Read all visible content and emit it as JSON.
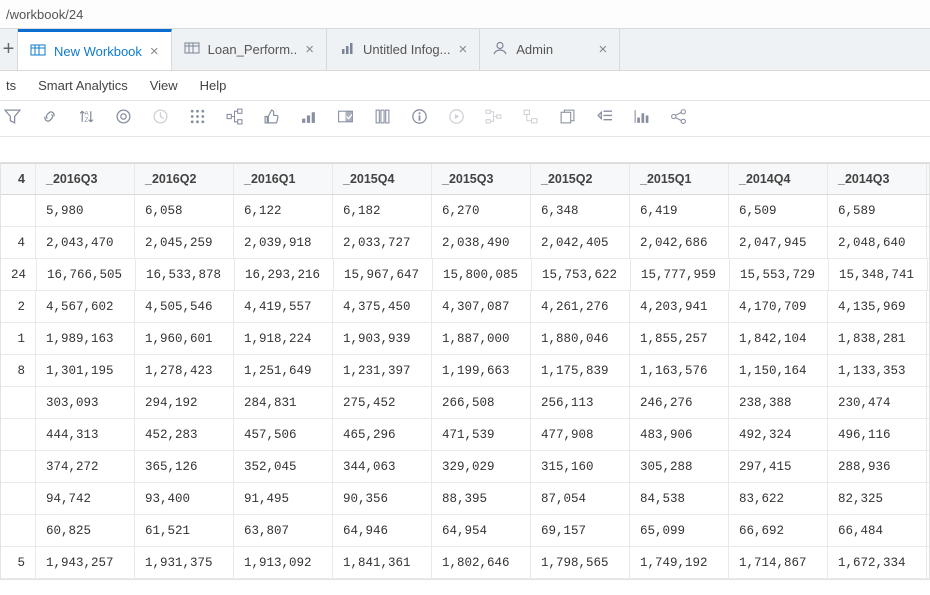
{
  "url": "/workbook/24",
  "tabs": [
    {
      "label": "New Workbook",
      "kind": "workbook",
      "active": true
    },
    {
      "label": "Loan_Perform..",
      "kind": "workbook",
      "active": false
    },
    {
      "label": "Untitled Infog...",
      "kind": "infographic",
      "active": false
    },
    {
      "label": "Admin",
      "kind": "admin",
      "active": false
    }
  ],
  "menu": {
    "m0": "ts",
    "m1": "Smart Analytics",
    "m2": "View",
    "m3": "Help"
  },
  "toolbar_icons": [
    "funnel-icon",
    "link-icon",
    "sort-icon",
    "ring-icon",
    "clock-icon",
    "grid-dots-icon",
    "tree-icon",
    "thumbs-up-icon",
    "bars-step-icon",
    "kpi-card-icon",
    "columns-icon",
    "info-icon",
    "play-icon",
    "flow1-icon",
    "flow2-icon",
    "copy-out-icon",
    "outdent-icon",
    "bar-chart-icon",
    "share-nodes-icon"
  ],
  "chart_data": {
    "type": "table",
    "title": "",
    "columns": [
      "_2016Q3",
      "_2016Q2",
      "_2016Q1",
      "_2015Q4",
      "_2015Q3",
      "_2015Q2",
      "_2015Q1",
      "_2014Q4",
      "_2014Q3"
    ],
    "row_leads": [
      "",
      "4",
      "24",
      "2",
      "1",
      "8",
      "",
      "",
      "",
      "",
      "",
      "5"
    ],
    "rows": [
      [
        "5,980",
        "6,058",
        "6,122",
        "6,182",
        "6,270",
        "6,348",
        "6,419",
        "6,509",
        "6,589"
      ],
      [
        "2,043,470",
        "2,045,259",
        "2,039,918",
        "2,033,727",
        "2,038,490",
        "2,042,405",
        "2,042,686",
        "2,047,945",
        "2,048,640"
      ],
      [
        "16,766,505",
        "16,533,878",
        "16,293,216",
        "15,967,647",
        "15,800,085",
        "15,753,622",
        "15,777,959",
        "15,553,729",
        "15,348,741"
      ],
      [
        "4,567,602",
        "4,505,546",
        "4,419,557",
        "4,375,450",
        "4,307,087",
        "4,261,276",
        "4,203,941",
        "4,170,709",
        "4,135,969"
      ],
      [
        "1,989,163",
        "1,960,601",
        "1,918,224",
        "1,903,939",
        "1,887,000",
        "1,880,046",
        "1,855,257",
        "1,842,104",
        "1,838,281"
      ],
      [
        "1,301,195",
        "1,278,423",
        "1,251,649",
        "1,231,397",
        "1,199,663",
        "1,175,839",
        "1,163,576",
        "1,150,164",
        "1,133,353"
      ],
      [
        "303,093",
        "294,192",
        "284,831",
        "275,452",
        "266,508",
        "256,113",
        "246,276",
        "238,388",
        "230,474"
      ],
      [
        "444,313",
        "452,283",
        "457,506",
        "465,296",
        "471,539",
        "477,908",
        "483,906",
        "492,324",
        "496,116"
      ],
      [
        "374,272",
        "365,126",
        "352,045",
        "344,063",
        "329,029",
        "315,160",
        "305,288",
        "297,415",
        "288,936"
      ],
      [
        "94,742",
        "93,400",
        "91,495",
        "90,356",
        "88,395",
        "87,054",
        "84,538",
        "83,622",
        "82,325"
      ],
      [
        "60,825",
        "61,521",
        "63,807",
        "64,946",
        "64,954",
        "69,157",
        "65,099",
        "66,692",
        "66,484"
      ],
      [
        "1,943,257",
        "1,931,375",
        "1,913,092",
        "1,841,361",
        "1,802,646",
        "1,798,565",
        "1,749,192",
        "1,714,867",
        "1,672,334"
      ]
    ],
    "header_lead": "4"
  }
}
